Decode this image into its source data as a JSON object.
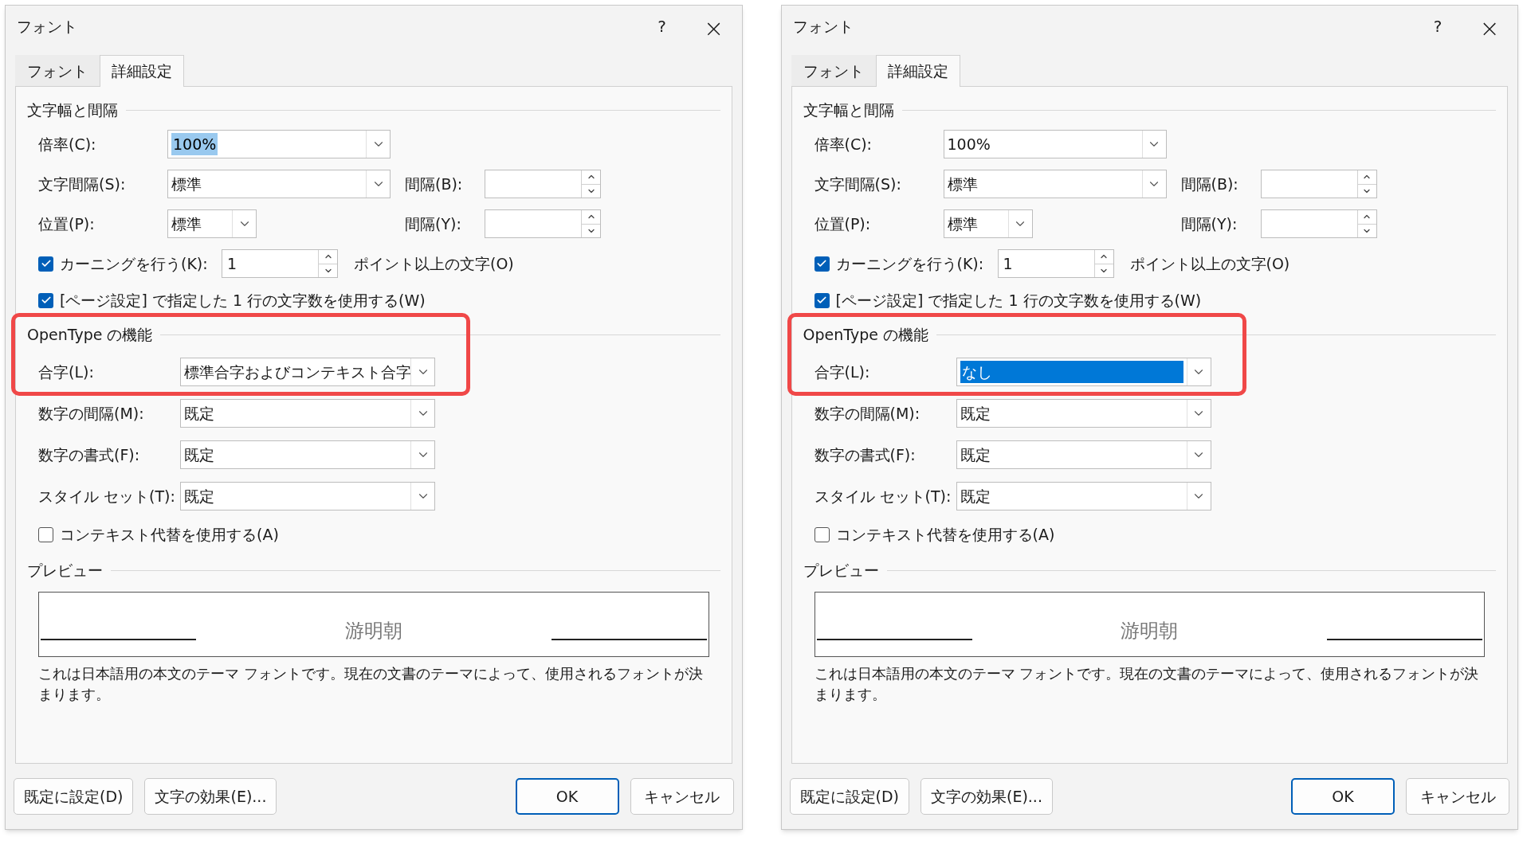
{
  "dialogs": [
    {
      "title": "フォント",
      "help": "?",
      "close": "×",
      "tabs": [
        {
          "label": "フォント",
          "selected": false
        },
        {
          "label": "詳細設定",
          "selected": true
        }
      ],
      "spacing": {
        "heading": "文字幅と間隔",
        "scale": {
          "label": "倍率(C):",
          "value": "100%",
          "value_selected": true,
          "focused": false
        },
        "char_spacing": {
          "label": "文字間隔(S):",
          "value": "標準"
        },
        "char_spacing_by": {
          "label": "間隔(B):"
        },
        "position": {
          "label": "位置(P):",
          "value": "標準"
        },
        "position_by": {
          "label": "間隔(Y):"
        },
        "kerning": {
          "label": "カーニングを行う(K):",
          "checked": true,
          "value": "1",
          "suffix": "ポイント以上の文字(O)"
        },
        "grid": {
          "label": "[ページ設定] で指定した 1 行の文字数を使用する(W)",
          "checked": true
        }
      },
      "opentype": {
        "heading": "OpenType の機能",
        "highlighted": true,
        "combos": [
          {
            "label": "合字(L):",
            "value": "標準合字およびコンテキスト合字",
            "value_selected": false
          },
          {
            "label": "数字の間隔(M):",
            "value": "既定"
          },
          {
            "label": "数字の書式(F):",
            "value": "既定"
          },
          {
            "label": "スタイル セット(T):",
            "value": "既定"
          }
        ],
        "contextual": {
          "label": "コンテキスト代替を使用する(A)",
          "checked": false
        }
      },
      "preview": {
        "heading": "プレビュー",
        "sample": "游明朝",
        "description": "これは日本語用の本文のテーマ フォントです。現在の文書のテーマによって、使用されるフォントが決まります。"
      },
      "buttons": [
        {
          "label": "既定に設定(D)",
          "primary": false
        },
        {
          "label": "文字の効果(E)...",
          "primary": false
        },
        {
          "label": "OK",
          "primary": true
        },
        {
          "label": "キャンセル",
          "primary": false
        }
      ]
    },
    {
      "title": "フォント",
      "help": "?",
      "close": "×",
      "tabs": [
        {
          "label": "フォント",
          "selected": false
        },
        {
          "label": "詳細設定",
          "selected": true
        }
      ],
      "spacing": {
        "heading": "文字幅と間隔",
        "scale": {
          "label": "倍率(C):",
          "value": "100%",
          "value_selected": false
        },
        "char_spacing": {
          "label": "文字間隔(S):",
          "value": "標準"
        },
        "char_spacing_by": {
          "label": "間隔(B):"
        },
        "position": {
          "label": "位置(P):",
          "value": "標準"
        },
        "position_by": {
          "label": "間隔(Y):"
        },
        "kerning": {
          "label": "カーニングを行う(K):",
          "checked": true,
          "value": "1",
          "suffix": "ポイント以上の文字(O)"
        },
        "grid": {
          "label": "[ページ設定] で指定した 1 行の文字数を使用する(W)",
          "checked": true
        }
      },
      "opentype": {
        "heading": "OpenType の機能",
        "highlighted": true,
        "combos": [
          {
            "label": "合字(L):",
            "value": "なし",
            "value_selected": true,
            "focused": true
          },
          {
            "label": "数字の間隔(M):",
            "value": "既定"
          },
          {
            "label": "数字の書式(F):",
            "value": "既定"
          },
          {
            "label": "スタイル セット(T):",
            "value": "既定"
          }
        ],
        "contextual": {
          "label": "コンテキスト代替を使用する(A)",
          "checked": false
        }
      },
      "preview": {
        "heading": "プレビュー",
        "sample": "游明朝",
        "description": "これは日本語用の本文のテーマ フォントです。現在の文書のテーマによって、使用されるフォントが決まります。"
      },
      "buttons": [
        {
          "label": "既定に設定(D)",
          "primary": false
        },
        {
          "label": "文字の効果(E)...",
          "primary": false
        },
        {
          "label": "OK",
          "primary": true
        },
        {
          "label": "キャンセル",
          "primary": false
        }
      ]
    }
  ]
}
